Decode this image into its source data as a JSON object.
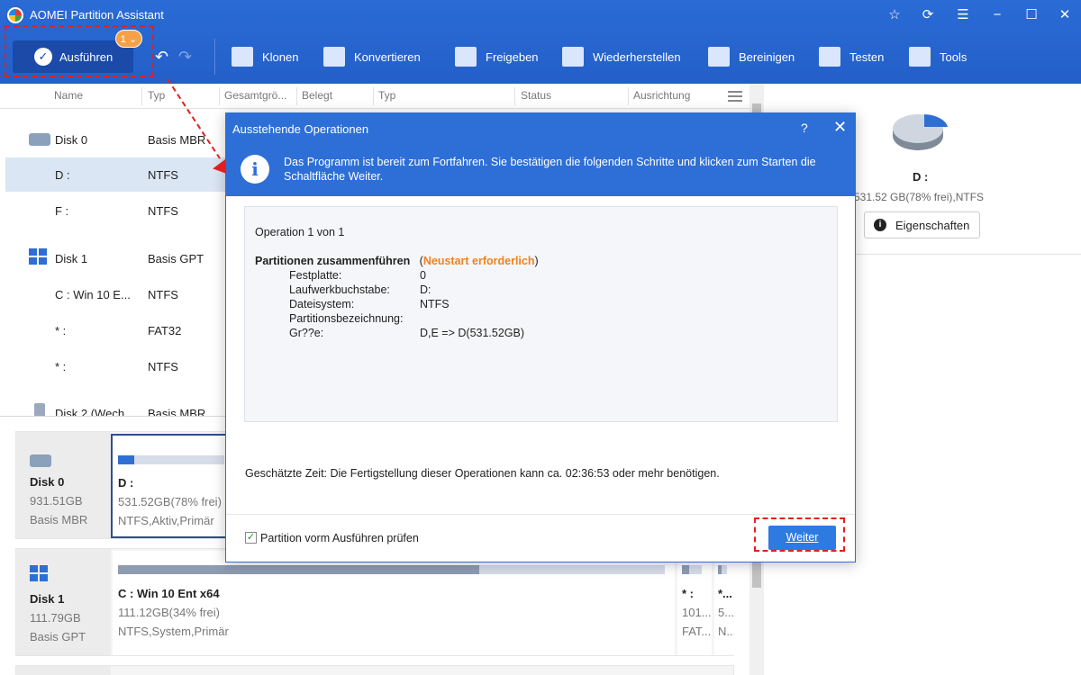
{
  "app": {
    "title": "AOMEI Partition Assistant"
  },
  "toolbar": {
    "execute_label": "Ausführen",
    "pending_badge": "1 ⌄",
    "items": [
      "Klonen",
      "Konvertieren",
      "Freigeben",
      "Wiederherstellen",
      "Bereinigen",
      "Testen",
      "Tools"
    ]
  },
  "columns": [
    "Name",
    "Typ",
    "Gesamtgrö...",
    "Belegt",
    "Typ",
    "Status",
    "Ausrichtung"
  ],
  "tree": [
    {
      "name": "Disk 0",
      "type": "Basis MBR"
    },
    {
      "name": "D :",
      "type": "NTFS"
    },
    {
      "name": "F :",
      "type": "NTFS"
    },
    {
      "name": "Disk 1",
      "type": "Basis GPT"
    },
    {
      "name": "C : Win 10 E...",
      "type": "NTFS"
    },
    {
      "name": "* :",
      "type": "FAT32"
    },
    {
      "name": "* :",
      "type": "NTFS"
    },
    {
      "name": "Disk 2 (Wech...",
      "type": "Basis MBR"
    }
  ],
  "cards": {
    "disk0": {
      "name": "Disk 0",
      "size": "931.51GB",
      "type": "Basis MBR",
      "part_d": {
        "name": "D :",
        "size": "531.52GB(78% frei)",
        "fs": "NTFS,Aktiv,Primär",
        "used_fraction": 0.22
      }
    },
    "disk1": {
      "name": "Disk 1",
      "size": "111.79GB",
      "type": "Basis GPT",
      "part_c": {
        "name": "C : Win 10 Ent x64",
        "size": "111.12GB(34% frei)",
        "fs": "NTFS,System,Primär",
        "used_fraction": 0.66
      },
      "part_2": {
        "name": "* :",
        "size": "101...",
        "fs": "FAT..."
      },
      "part_3": {
        "name": "*...",
        "size": "5...",
        "fs": "N..."
      }
    }
  },
  "right_pane": {
    "drive": "D :",
    "info": "531.52 GB(78% frei),NTFS",
    "properties_label": "Eigenschaften",
    "pie_free_fraction": 0.78
  },
  "dialog": {
    "title": "Ausstehende Operationen",
    "help": "?",
    "close": "✕",
    "message": "Das Programm ist bereit zum Fortfahren. Sie bestätigen die folgenden Schritte und klicken zum Starten die Schaltfläche Weiter.",
    "operation_count": "Operation 1 von 1",
    "operation_title": "Partitionen zusammenführen",
    "operation_warning": "Neustart erforderlich",
    "details": [
      {
        "label": "Festplatte:",
        "value": "0"
      },
      {
        "label": "Laufwerkbuchstabe:",
        "value": "D:"
      },
      {
        "label": "Dateisystem:",
        "value": "NTFS"
      },
      {
        "label": "Partitionsbezeichnung:",
        "value": ""
      },
      {
        "label": "Gr??e:",
        "value": "D,E => D(531.52GB)"
      }
    ],
    "estimate": "Geschätzte Zeit: Die Fertigstellung dieser Operationen kann ca. 02:36:53 oder mehr benötigen.",
    "checkbox_label": "Partition vorm Ausführen prüfen",
    "checkbox_checked": true,
    "next_label": "Weiter"
  }
}
